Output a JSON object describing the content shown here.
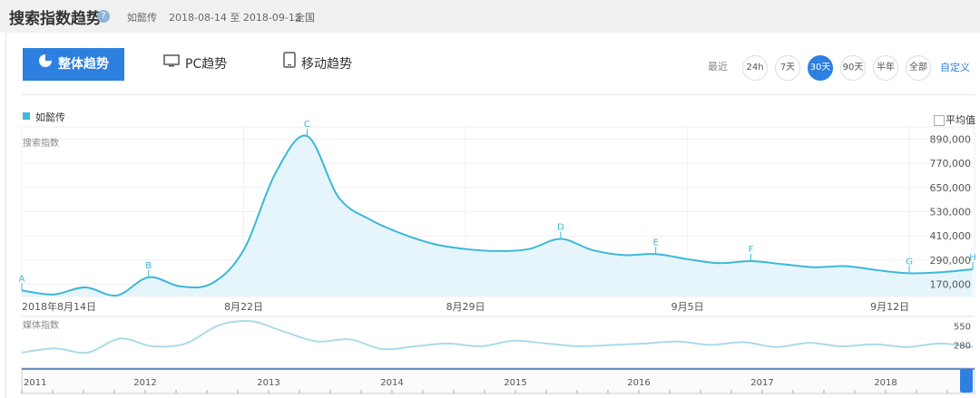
{
  "header": {
    "title": "搜索指数趋势",
    "keyword": "如懿传",
    "date_range": "2018-08-14 至 2018-09-12",
    "region": "全国"
  },
  "tabs": [
    {
      "label": "整体趋势",
      "active": true,
      "icon": "pie-icon"
    },
    {
      "label": "PC趋势",
      "active": false,
      "icon": "monitor-icon"
    },
    {
      "label": "移动趋势",
      "active": false,
      "icon": "tablet-icon"
    }
  ],
  "range": {
    "label": "最近",
    "options": [
      {
        "label": "24h",
        "active": false
      },
      {
        "label": "7天",
        "active": false
      },
      {
        "label": "30天",
        "active": true
      },
      {
        "label": "90天",
        "active": false
      },
      {
        "label": "半年",
        "active": false
      },
      {
        "label": "全部",
        "active": false
      }
    ],
    "custom": "自定义"
  },
  "legend": {
    "series_name": "如懿传",
    "average_label": "平均值"
  },
  "colors": {
    "accent": "#2d7fe0",
    "line": "#3cb8d8",
    "fill": "#e6f5fb",
    "media_line": "#aadbea"
  },
  "chart_data": [
    {
      "type": "area",
      "title": "搜索指数",
      "x_tick_labels": [
        "2018年8月14日",
        "8月22日",
        "8月29日",
        "9月5日",
        "9月12日"
      ],
      "y_tick_labels": [
        "890,000",
        "770,000",
        "650,000",
        "530,000",
        "410,000",
        "290,000",
        "170,000"
      ],
      "ylim": [
        110000,
        950000
      ],
      "grid": true,
      "series": [
        {
          "name": "如懿传",
          "values": [
            140000,
            120000,
            155000,
            115000,
            205000,
            160000,
            175000,
            340000,
            720000,
            905000,
            600000,
            490000,
            420000,
            370000,
            345000,
            335000,
            345000,
            395000,
            340000,
            315000,
            320000,
            295000,
            275000,
            285000,
            270000,
            255000,
            260000,
            240000,
            225000,
            230000,
            245000
          ]
        }
      ],
      "annotations": [
        {
          "label": "A",
          "index": 0
        },
        {
          "label": "B",
          "index": 4
        },
        {
          "label": "C",
          "index": 9
        },
        {
          "label": "D",
          "index": 17
        },
        {
          "label": "E",
          "index": 20
        },
        {
          "label": "F",
          "index": 23
        },
        {
          "label": "G",
          "index": 28
        },
        {
          "label": "H",
          "index": 30
        }
      ]
    },
    {
      "type": "line",
      "title": "媒体指数",
      "y_tick_labels": [
        "550",
        "280"
      ],
      "ylim": [
        0,
        650
      ],
      "series": [
        {
          "values": [
            170,
            230,
            170,
            370,
            260,
            300,
            560,
            620,
            470,
            330,
            360,
            220,
            260,
            300,
            260,
            340,
            300,
            260,
            280,
            300,
            330,
            280,
            320,
            250,
            310,
            260,
            290,
            250,
            300,
            250
          ]
        }
      ]
    }
  ],
  "navigator": {
    "year_labels": [
      "2011",
      "2012",
      "2013",
      "2014",
      "2015",
      "2016",
      "2017",
      "2018"
    ]
  }
}
